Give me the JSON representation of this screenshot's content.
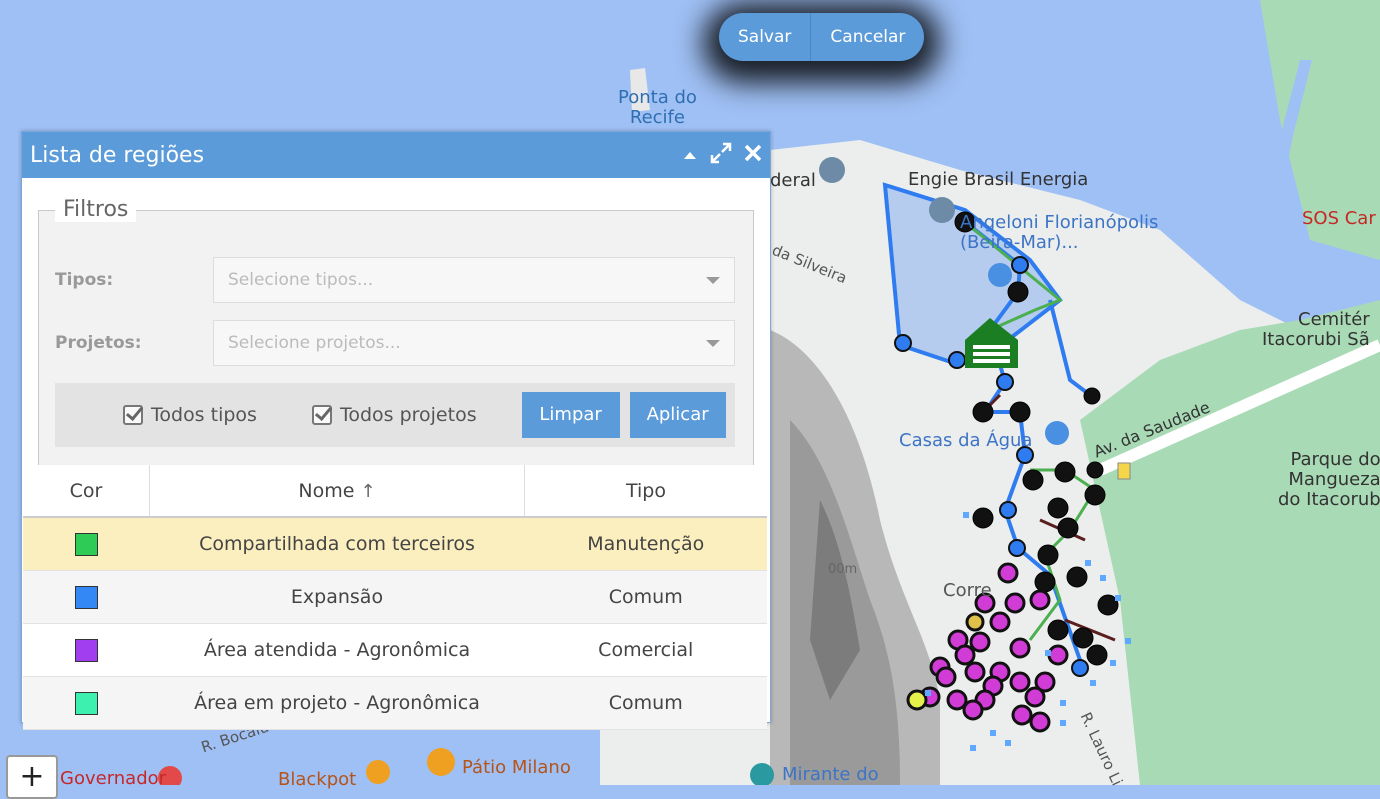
{
  "edit_bar": {
    "save_label": "Salvar",
    "cancel_label": "Cancelar"
  },
  "panel": {
    "title": "Lista de regiões",
    "filters": {
      "legend": "Filtros",
      "types_label": "Tipos:",
      "types_placeholder": "Selecione tipos...",
      "projects_label": "Projetos:",
      "projects_placeholder": "Selecione projetos...",
      "all_types_label": "Todos tipos",
      "all_projects_label": "Todos projetos",
      "clear_label": "Limpar",
      "apply_label": "Aplicar"
    },
    "table": {
      "columns": [
        "Cor",
        "Nome",
        "Tipo"
      ],
      "rows": [
        {
          "color": "#2ecc57",
          "name": "Compartilhada com terceiros",
          "type": "Manutenção"
        },
        {
          "color": "#3388f5",
          "name": "Expansão",
          "type": "Comum"
        },
        {
          "color": "#a03ef0",
          "name": "Área atendida - Agronômica",
          "type": "Comercial"
        },
        {
          "color": "#3ef0b0",
          "name": "Área em projeto - Agronômica",
          "type": "Comum"
        }
      ]
    }
  },
  "map": {
    "labels": {
      "ponta": "Ponta do\nRecife",
      "engie": "Engie Brasil Energia",
      "angeloni": "Angeloni Florianópolis\n(Beira-Mar)...",
      "sos": "SOS Car",
      "cemiterio": "Cemitér\nItacorubi Sã",
      "casas": "Casas da Água",
      "saudade": "Av. da Saudade",
      "parque": "Parque do\nMangueza\ndo Itacorub",
      "patio": "Pátio Milano",
      "blackpot": "Blackpot",
      "governador": "Governador",
      "mirante": "Mirante do",
      "correio": "Corre",
      "federal": "deral",
      "silveira": "da Silveira",
      "bocaiuva": "R. Bocaiu",
      "lauro": "R. Lauro Li",
      "elevation": "00m"
    },
    "zoom_in_label": "+",
    "colors": {
      "water": "#9fc0f5",
      "land": "#eef0ef",
      "green": "#a8dab5",
      "region": "#2f7cf0"
    }
  }
}
